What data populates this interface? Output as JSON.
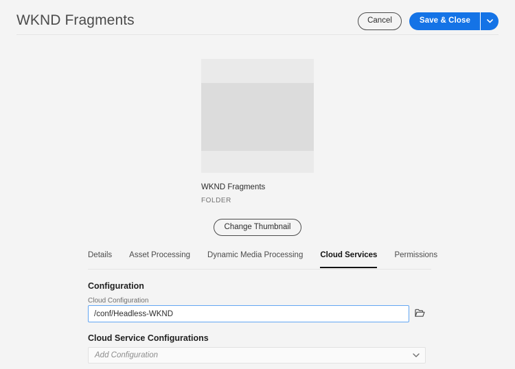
{
  "header": {
    "title": "WKND Fragments",
    "cancel_label": "Cancel",
    "save_label": "Save & Close",
    "save_more_icon": "chevron-down-icon"
  },
  "thumbnail": {
    "name": "WKND Fragments",
    "type": "FOLDER",
    "change_label": "Change Thumbnail"
  },
  "tabs": [
    {
      "label": "Details",
      "active": false
    },
    {
      "label": "Asset Processing",
      "active": false
    },
    {
      "label": "Dynamic Media Processing",
      "active": false
    },
    {
      "label": "Cloud Services",
      "active": true
    },
    {
      "label": "Permissions",
      "active": false
    }
  ],
  "configuration": {
    "heading": "Configuration",
    "field_label": "Cloud Configuration",
    "field_value": "/conf/Headless-WKND",
    "field_placeholder": "",
    "browse_icon": "folder-icon"
  },
  "cloud_services": {
    "heading": "Cloud Service Configurations",
    "select_placeholder": "Add Configuration",
    "select_value": "",
    "chevron_icon": "chevron-down-icon"
  },
  "colors": {
    "accent": "#1473E6",
    "page_background": "#F4F4F4",
    "focus_border": "#61A5F2",
    "text_primary": "#2C2C2C",
    "text_secondary": "#6E6E6E"
  }
}
